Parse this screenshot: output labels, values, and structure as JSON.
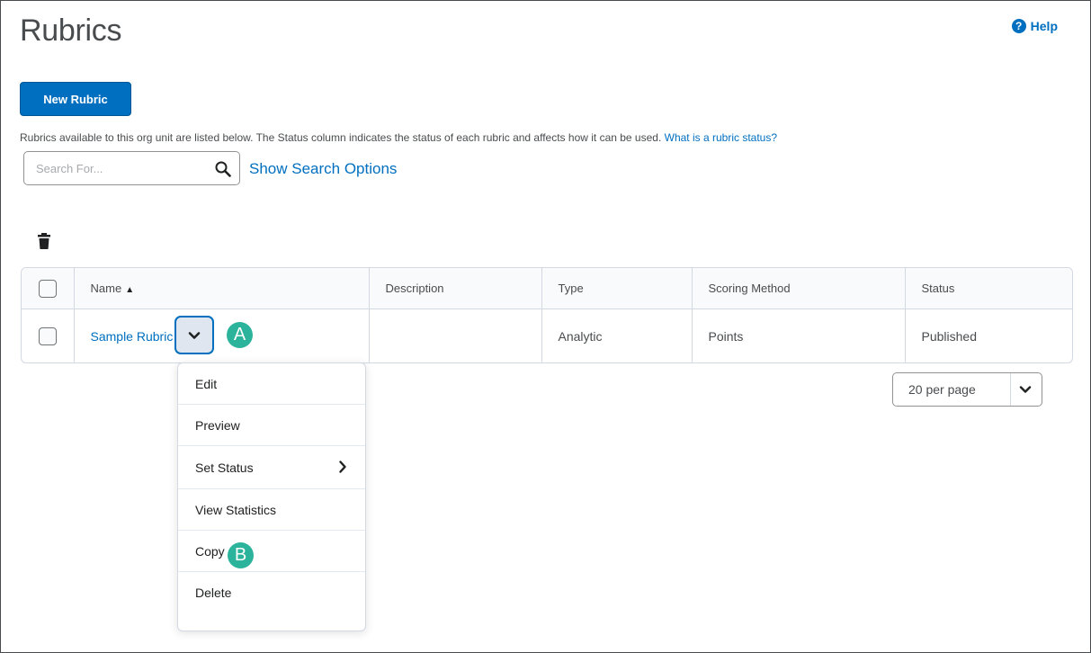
{
  "page": {
    "title": "Rubrics",
    "help_label": "Help",
    "help_glyph": "?"
  },
  "toolbar": {
    "new_rubric_label": "New Rubric"
  },
  "intro": {
    "text": "Rubrics available to this org unit are listed below. The Status column indicates the status of each rubric and affects how it can be used. ",
    "link": "What is a rubric status?"
  },
  "search": {
    "placeholder": "Search For...",
    "value": "",
    "options_label": "Show Search Options"
  },
  "table": {
    "columns": [
      "Name",
      "Description",
      "Type",
      "Scoring Method",
      "Status"
    ],
    "sort_indicator": "▲",
    "rows": [
      {
        "name": "Sample Rubric",
        "description": "",
        "type": "Analytic",
        "scoring_method": "Points",
        "status": "Published"
      }
    ]
  },
  "context_menu": {
    "items": [
      "Edit",
      "Preview",
      "Set Status",
      "View Statistics",
      "Copy",
      "Delete"
    ]
  },
  "callouts": {
    "a": "A",
    "b": "B"
  },
  "pager": {
    "per_page": "20 per page"
  },
  "colors": {
    "accent": "#006fbf",
    "callout": "#2bb39b",
    "border": "#d3d9e3"
  },
  "icons": [
    "help-icon",
    "search-icon",
    "trash-icon",
    "sort-up-icon",
    "chevron-down-icon",
    "chevron-right-icon"
  ]
}
